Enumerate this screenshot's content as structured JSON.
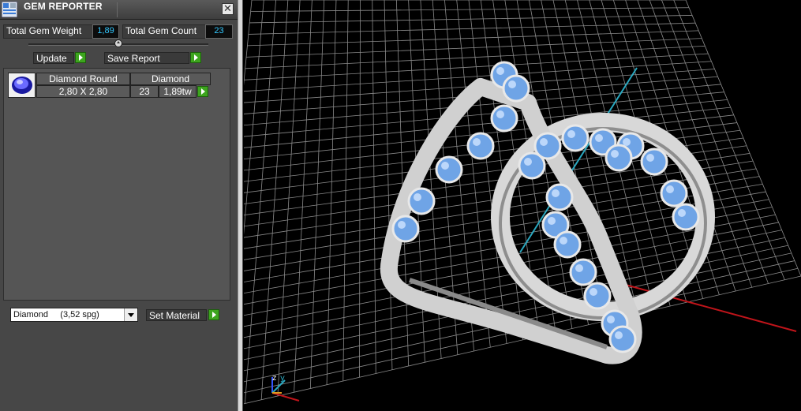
{
  "panel": {
    "title": "GEM REPORTER",
    "close_glyph": "✕",
    "total_weight_label": "Total Gem Weight",
    "total_weight_value": "1,89",
    "total_count_label": "Total Gem Count",
    "total_count_value": "23",
    "update_label": "Update",
    "save_report_label": "Save Report",
    "gems": [
      {
        "name": "Diamond Round",
        "material": "Diamond",
        "size": "2,80 X 2,80",
        "count": "23",
        "weight": "1,89tw"
      }
    ],
    "material_select_value": "Diamond     (3,52 spg)",
    "set_material_label": "Set Material"
  },
  "viewport": {
    "axis_icons": {
      "z": "z",
      "y": "y"
    }
  },
  "icons": {
    "app": "gem-reporter-app-icon",
    "close": "close-icon",
    "play": "play-arrow-icon",
    "dropdown": "chevron-down-icon",
    "gem_thumbnail": "round-gem-icon"
  },
  "colors": {
    "value_text": "#33c8ff",
    "play_green": "#3da51e",
    "grid": "#8a8a8a",
    "axis_x": "#c0141a",
    "axis_y": "#2aa8c0",
    "gem_blue": "#6fa4e6",
    "metal": "#c9c9c9"
  }
}
